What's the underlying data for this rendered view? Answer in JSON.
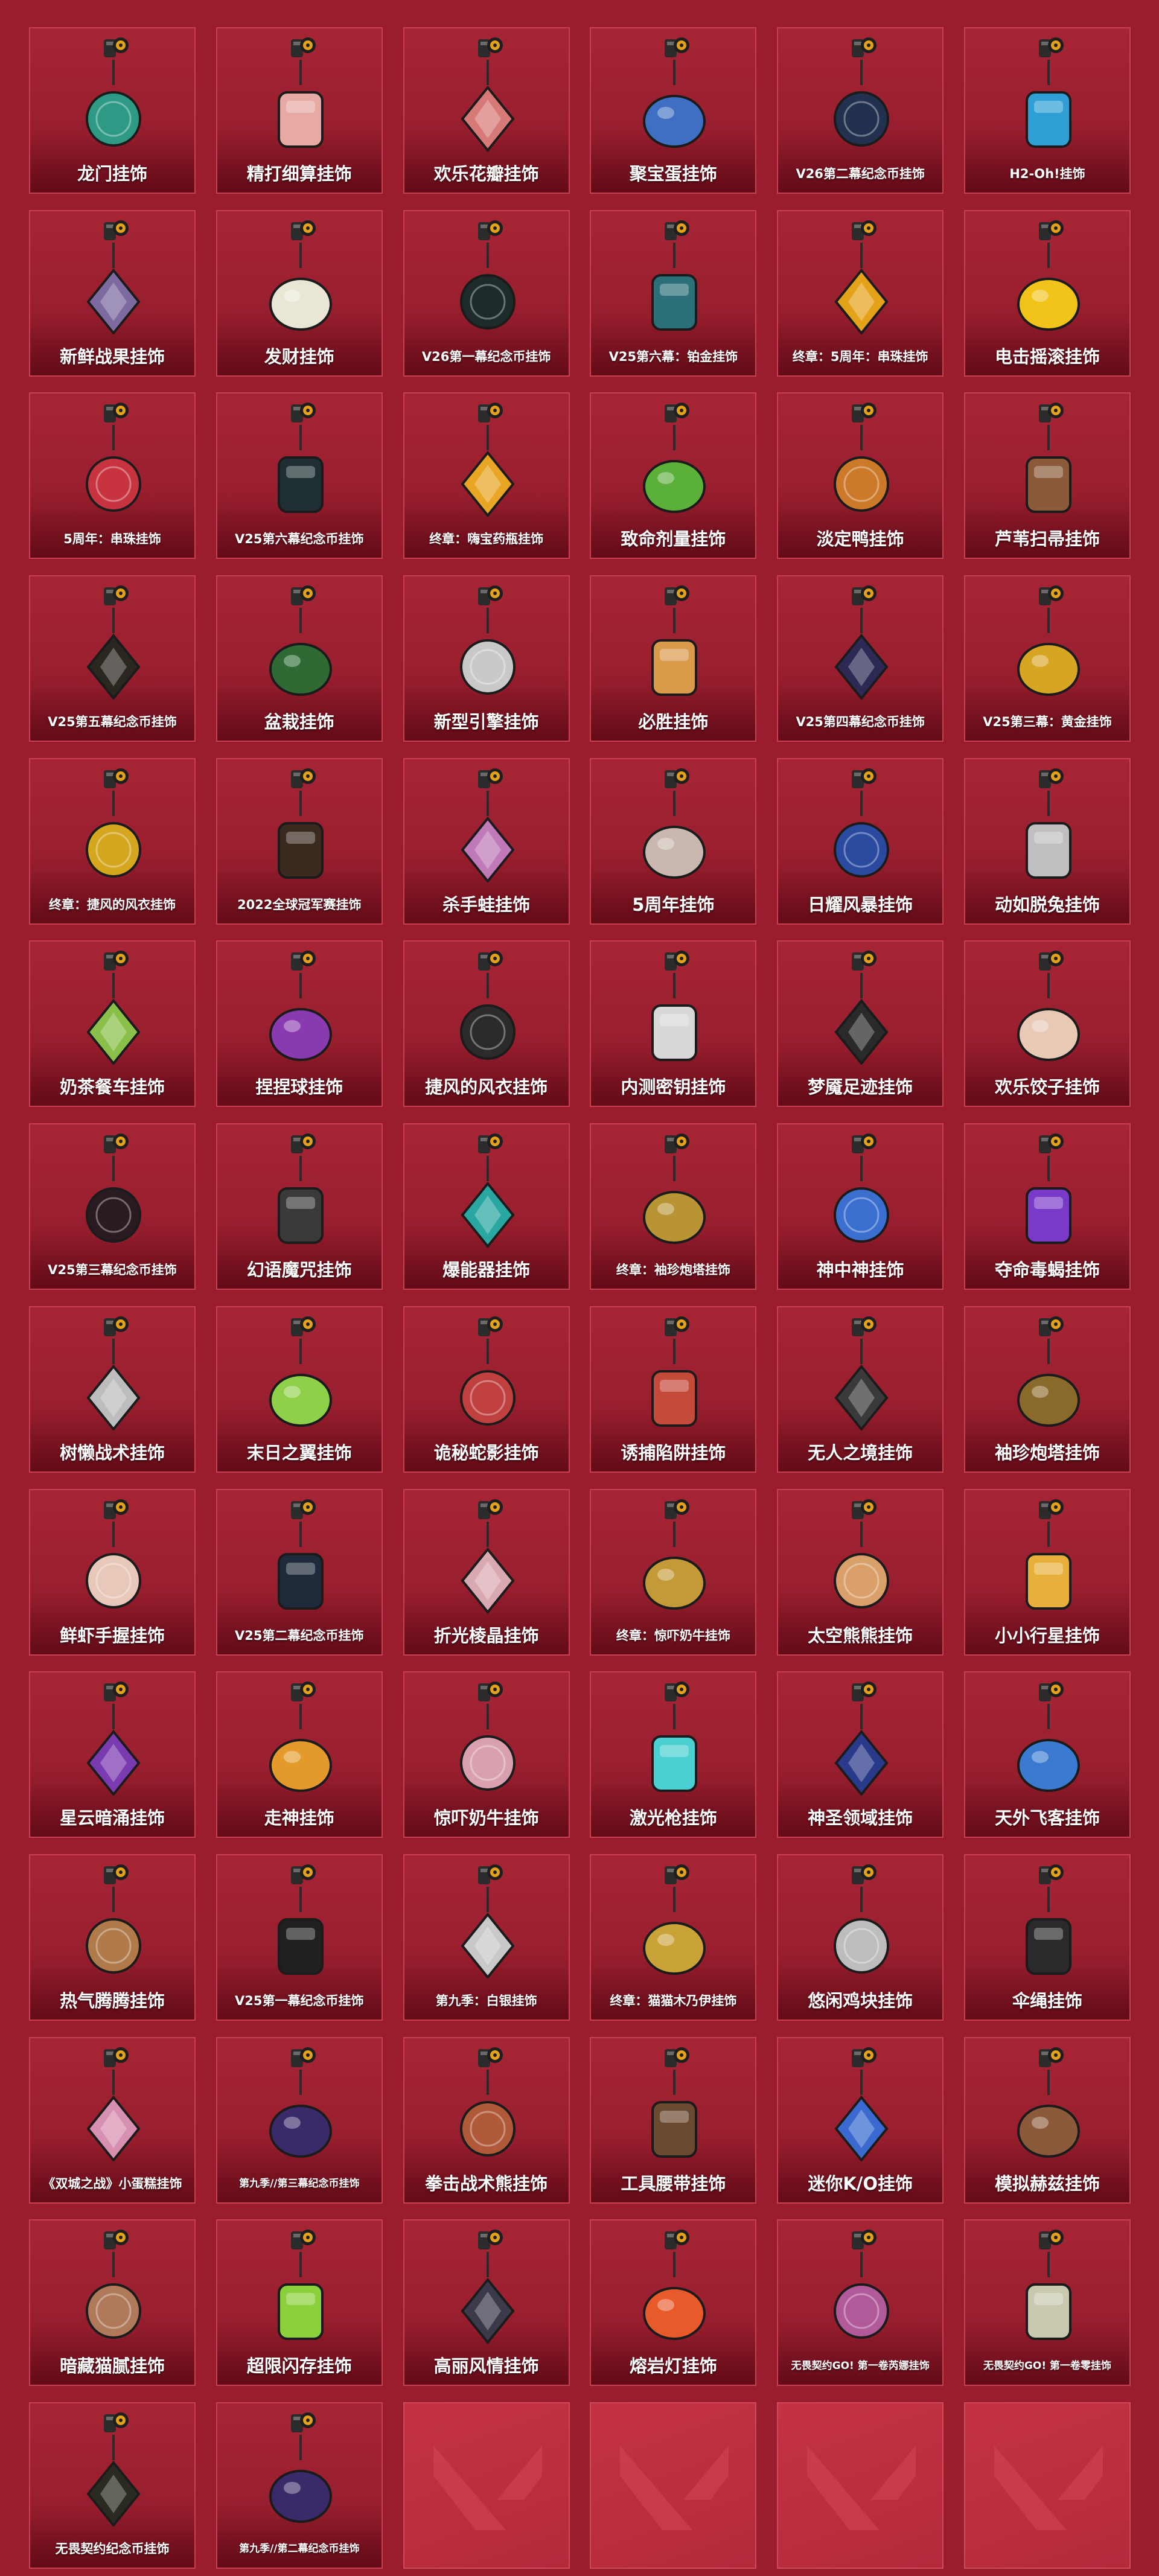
{
  "colors": {
    "page_background": "#991d2c",
    "tile_border": "#c8404f",
    "label_text": "#ffffff",
    "clip_gold": "#e3a21a"
  },
  "charms": [
    {
      "name": "龙门挂饰",
      "icon": "dragon-gate-charm-icon",
      "color": "#2e9a86"
    },
    {
      "name": "精打细算挂饰",
      "icon": "piggy-bank-charm-icon",
      "color": "#e7a9a3"
    },
    {
      "name": "欢乐花瓣挂饰",
      "icon": "flower-moon-charm-icon",
      "color": "#d77a77"
    },
    {
      "name": "聚宝蛋挂饰",
      "icon": "treasure-egg-charm-icon",
      "color": "#3f6fc2"
    },
    {
      "name": "V26第二幕纪念币挂饰",
      "icon": "v26-act2-coin-charm-icon",
      "color": "#22314f"
    },
    {
      "name": "H2-Oh!挂饰",
      "icon": "water-bottle-charm-icon",
      "color": "#2f9fd5"
    },
    {
      "name": "新鲜战果挂饰",
      "icon": "fresh-fruit-charm-icon",
      "color": "#7c6aa0"
    },
    {
      "name": "发财挂饰",
      "icon": "mahjong-tile-charm-icon",
      "color": "#e9e6d6"
    },
    {
      "name": "V26第一幕纪念币挂饰",
      "icon": "v26-act1-coin-charm-icon",
      "color": "#1d2b2a"
    },
    {
      "name": "V25第六幕：铂金挂饰",
      "icon": "v25-platinum-charm-icon",
      "color": "#2b6f78"
    },
    {
      "name": "终章：5周年：串珠挂饰",
      "icon": "5th-anniversary-beads-charm-icon",
      "color": "#e3a21a"
    },
    {
      "name": "电击摇滚挂饰",
      "icon": "electric-rock-charm-icon",
      "color": "#f2c318"
    },
    {
      "name": "5周年：串珠挂饰",
      "icon": "5th-anniversary-wreath-charm-icon",
      "color": "#c7333f"
    },
    {
      "name": "V25第六幕纪念币挂饰",
      "icon": "v25-act6-coin-charm-icon",
      "color": "#1f2e33"
    },
    {
      "name": "终章：嗨宝药瓶挂饰",
      "icon": "potion-bottle-charm-icon",
      "color": "#e8a624"
    },
    {
      "name": "致命剂量挂饰",
      "icon": "lethal-dose-charm-icon",
      "color": "#5bb03a"
    },
    {
      "name": "淡定鸭挂饰",
      "icon": "calm-duck-charm-icon",
      "color": "#cc7a2a"
    },
    {
      "name": "芦苇扫帚挂饰",
      "icon": "reed-broom-charm-icon",
      "color": "#8a5a3a"
    },
    {
      "name": "V25第五幕纪念币挂饰",
      "icon": "v25-act5-coin-charm-icon",
      "color": "#2a2620"
    },
    {
      "name": "盆栽挂饰",
      "icon": "bonsai-charm-icon",
      "color": "#2f6a35"
    },
    {
      "name": "新型引擎挂饰",
      "icon": "rocket-engine-charm-icon",
      "color": "#c9c9c9"
    },
    {
      "name": "必胜挂饰",
      "icon": "pizza-slice-charm-icon",
      "color": "#d99a4a"
    },
    {
      "name": "V25第四幕纪念币挂饰",
      "icon": "v25-act4-coin-charm-icon",
      "color": "#2c2a55"
    },
    {
      "name": "V25第三幕：黄金挂饰",
      "icon": "v25-gold-charm-icon",
      "color": "#d6a521"
    },
    {
      "name": "终章：捷风的风衣挂饰",
      "icon": "jett-jacket-gold-charm-icon",
      "color": "#d4a71f"
    },
    {
      "name": "2022全球冠军赛挂饰",
      "icon": "champions-2022-charm-icon",
      "color": "#3a2a20"
    },
    {
      "name": "杀手蛙挂饰",
      "icon": "killer-frog-charm-icon",
      "color": "#c07ab8"
    },
    {
      "name": "5周年挂饰",
      "icon": "5th-anniversary-pennant-charm-icon",
      "color": "#c9b7b0"
    },
    {
      "name": "日耀风暴挂饰",
      "icon": "sun-storm-crystal-charm-icon",
      "color": "#2a4aa0"
    },
    {
      "name": "动如脱兔挂饰",
      "icon": "rabbit-charm-icon",
      "color": "#bfbfbf"
    },
    {
      "name": "奶茶餐车挂饰",
      "icon": "milk-tea-truck-charm-icon",
      "color": "#8ac04a"
    },
    {
      "name": "捏捏球挂饰",
      "icon": "squish-ball-charm-icon",
      "color": "#8a3ab0"
    },
    {
      "name": "捷风的风衣挂饰",
      "icon": "jett-jacket-charm-icon",
      "color": "#2b2b2b"
    },
    {
      "name": "内测密钥挂饰",
      "icon": "beta-key-charm-icon",
      "color": "#d8d8d8"
    },
    {
      "name": "梦魇足迹挂饰",
      "icon": "nightmare-footprint-charm-icon",
      "color": "#2a2a2a"
    },
    {
      "name": "欢乐饺子挂饰",
      "icon": "dumpling-charm-icon",
      "color": "#e8c9b6"
    },
    {
      "name": "V25第三幕纪念币挂饰",
      "icon": "v25-act3-coin-charm-icon",
      "color": "#2a1b22"
    },
    {
      "name": "幻语魔咒挂饰",
      "icon": "spell-book-charm-icon",
      "color": "#3a3a3a"
    },
    {
      "name": "爆能器挂饰",
      "icon": "blaster-charm-icon",
      "color": "#2aa7a0"
    },
    {
      "name": "终章：袖珍炮塔挂饰",
      "icon": "pocket-turret-gold-charm-icon",
      "color": "#b89434"
    },
    {
      "name": "神中神挂饰",
      "icon": "god-blade-charm-icon",
      "color": "#3a6fd0"
    },
    {
      "name": "夺命毒蝎挂饰",
      "icon": "scorpion-charm-icon",
      "color": "#7a3ac9"
    },
    {
      "name": "树懒战术挂饰",
      "icon": "sloth-tactics-charm-icon",
      "color": "#bdbdbd"
    },
    {
      "name": "末日之翼挂饰",
      "icon": "doom-wing-charm-icon",
      "color": "#8fd04a"
    },
    {
      "name": "诡秘蛇影挂饰",
      "icon": "serpent-shadow-charm-icon",
      "color": "#c04040"
    },
    {
      "name": "诱捕陷阱挂饰",
      "icon": "snare-trap-charm-icon",
      "color": "#c44a3a"
    },
    {
      "name": "无人之境挂饰",
      "icon": "no-mans-land-charm-icon",
      "color": "#3a3a3a"
    },
    {
      "name": "袖珍炮塔挂饰",
      "icon": "pocket-turret-charm-icon",
      "color": "#8a6a2a"
    },
    {
      "name": "鲜虾手握挂饰",
      "icon": "shrimp-sushi-charm-icon",
      "color": "#e8c8b8"
    },
    {
      "name": "V25第二幕纪念币挂饰",
      "icon": "v25-act2-coin-charm-icon",
      "color": "#1f2b3a"
    },
    {
      "name": "折光棱晶挂饰",
      "icon": "prism-crystal-charm-icon",
      "color": "#d8a9b0"
    },
    {
      "name": "终章：惊吓奶牛挂饰",
      "icon": "scared-cow-gold-charm-icon",
      "color": "#c49a38"
    },
    {
      "name": "太空熊熊挂饰",
      "icon": "space-bear-charm-icon",
      "color": "#d9a06a"
    },
    {
      "name": "小小行星挂饰",
      "icon": "little-planet-charm-icon",
      "color": "#e8b03a"
    },
    {
      "name": "星云暗涌挂饰",
      "icon": "nebula-surge-charm-icon",
      "color": "#7a3ab0"
    },
    {
      "name": "走神挂饰",
      "icon": "distracted-fox-charm-icon",
      "color": "#e39a2a"
    },
    {
      "name": "惊吓奶牛挂饰",
      "icon": "scared-cow-charm-icon",
      "color": "#d9a0b0"
    },
    {
      "name": "激光枪挂饰",
      "icon": "laser-gun-charm-icon",
      "color": "#4ad0d0"
    },
    {
      "name": "神圣领域挂饰",
      "icon": "sacred-realm-charm-icon",
      "color": "#2a3a8a"
    },
    {
      "name": "天外飞客挂饰",
      "icon": "ufo-charm-icon",
      "color": "#3a7ad0"
    },
    {
      "name": "热气腾腾挂饰",
      "icon": "hot-pot-charm-icon",
      "color": "#b07a4a"
    },
    {
      "name": "V25第一幕纪念币挂饰",
      "icon": "v25-act1-coin-charm-icon",
      "color": "#20201f"
    },
    {
      "name": "第九季：白银挂饰",
      "icon": "season9-silver-charm-icon",
      "color": "#c9c9c9"
    },
    {
      "name": "终章：猫猫木乃伊挂饰",
      "icon": "mummy-cat-gold-charm-icon",
      "color": "#c9a238"
    },
    {
      "name": "悠闲鸡块挂饰",
      "icon": "chicken-nugget-charm-icon",
      "color": "#bdbdbd"
    },
    {
      "name": "伞绳挂饰",
      "icon": "paracord-charm-icon",
      "color": "#2a2a2a"
    },
    {
      "name": "《双城之战》小蛋糕挂饰",
      "icon": "arcane-cupcake-charm-icon",
      "color": "#d890b0"
    },
    {
      "name": "第九季//第三幕纪念币挂饰",
      "icon": "ep9-act3-coin-charm-icon",
      "color": "#3a2a6a"
    },
    {
      "name": "拳击战术熊挂饰",
      "icon": "boxing-bear-charm-icon",
      "color": "#b05a3a"
    },
    {
      "name": "工具腰带挂饰",
      "icon": "tool-belt-charm-icon",
      "color": "#6a4a30"
    },
    {
      "name": "迷你K/O挂饰",
      "icon": "mini-ko-charm-icon",
      "color": "#3a6ad0"
    },
    {
      "name": "模拟赫兹挂饰",
      "icon": "analog-hertz-charm-icon",
      "color": "#8a5a3a"
    },
    {
      "name": "暗藏猫腻挂饰",
      "icon": "hidden-cat-box-charm-icon",
      "color": "#b07a5a"
    },
    {
      "name": "超限闪存挂饰",
      "icon": "overflow-flash-charm-icon",
      "color": "#8ad03a"
    },
    {
      "name": "高丽风情挂饰",
      "icon": "korean-charm-icon",
      "color": "#3a3a4a"
    },
    {
      "name": "熔岩灯挂饰",
      "icon": "lava-lamp-charm-icon",
      "color": "#e85a2a"
    },
    {
      "name": "无畏契约GO! 第一卷芮娜挂饰",
      "icon": "go-vol1-reyna-charm-icon",
      "color": "#b05a9a"
    },
    {
      "name": "无畏契约GO! 第一卷零挂饰",
      "icon": "go-vol1-cypher-charm-icon",
      "color": "#c9c9b0"
    },
    {
      "name": "无畏契约纪念币挂饰",
      "icon": "valorant-coin-charm-icon",
      "color": "#2a2a20"
    },
    {
      "name": "第九季//第二幕纪念币挂饰",
      "icon": "ep9-act2-coin-charm-icon",
      "color": "#3a2a6a"
    }
  ],
  "empty_slots": 4
}
